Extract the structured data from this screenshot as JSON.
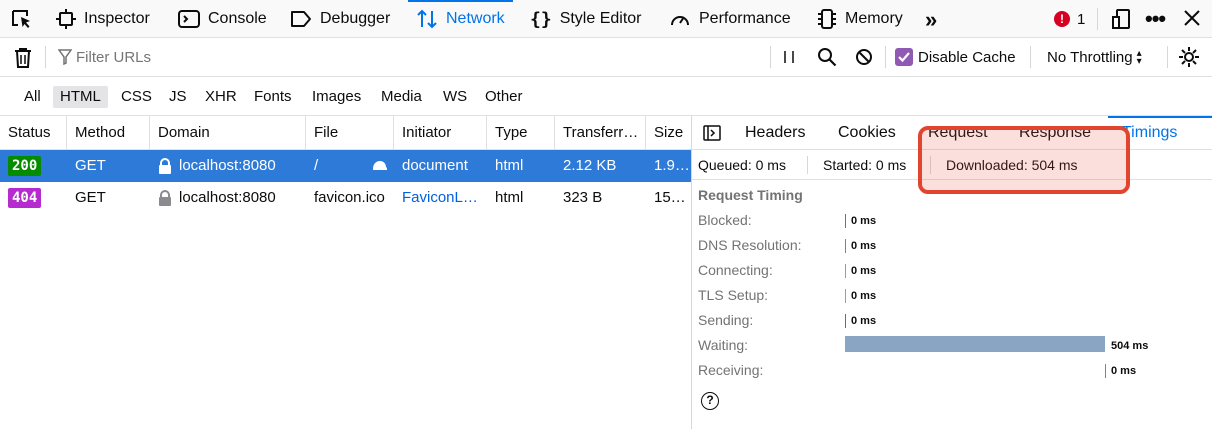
{
  "toolbar": {
    "tools": {
      "inspector": "Inspector",
      "console": "Console",
      "debugger": "Debugger",
      "network": "Network",
      "style_editor": "Style Editor",
      "performance": "Performance",
      "memory": "Memory"
    },
    "error_count": "1",
    "accent_color": "#0074e8"
  },
  "filterbar": {
    "filter_placeholder": "Filter URLs",
    "disable_cache_label": "Disable Cache",
    "disable_cache_checked": true,
    "throttling_label": "No Throttling"
  },
  "type_filters": [
    "All",
    "HTML",
    "CSS",
    "JS",
    "XHR",
    "Fonts",
    "Images",
    "Media",
    "WS",
    "Other"
  ],
  "type_filter_active": "HTML",
  "table": {
    "columns": [
      "Status",
      "Method",
      "Domain",
      "File",
      "Initiator",
      "Type",
      "Transferr…",
      "Size"
    ],
    "rows": [
      {
        "status": "200",
        "method": "GET",
        "domain": "localhost:8080",
        "file": "/",
        "initiator": "document",
        "type": "html",
        "transferred": "2.12 KB",
        "size": "1.9…",
        "status_color": "#058b00",
        "selected": true
      },
      {
        "status": "404",
        "method": "GET",
        "domain": "localhost:8080",
        "file": "favicon.ico",
        "initiator": "FaviconL…",
        "type": "html",
        "transferred": "323 B",
        "size": "15…",
        "status_color": "#b62bd0",
        "selected": false
      }
    ]
  },
  "panel": {
    "tabs": [
      "Headers",
      "Cookies",
      "Request",
      "Response",
      "Timings"
    ],
    "active_tab": "Timings",
    "summary": {
      "queued": "Queued: 0 ms",
      "started": "Started: 0 ms",
      "downloaded": "Downloaded: 504 ms"
    },
    "section_title": "Request Timing",
    "timings": [
      {
        "label": "Blocked:",
        "value": "0 ms",
        "color": "#e1452e"
      },
      {
        "label": "DNS Resolution:",
        "value": "0 ms",
        "color": "#8b6dd6"
      },
      {
        "label": "Connecting:",
        "value": "0 ms",
        "color": "#e08a3c"
      },
      {
        "label": "TLS Setup:",
        "value": "0 ms",
        "color": "#e08a3c"
      },
      {
        "label": "Sending:",
        "value": "0 ms",
        "color": "#2c7ec0"
      },
      {
        "label": "Waiting:",
        "value": "504 ms",
        "color": "#8aa5c3",
        "fraction": 1.0
      },
      {
        "label": "Receiving:",
        "value": "0 ms",
        "color": "#4caf3a"
      }
    ]
  }
}
